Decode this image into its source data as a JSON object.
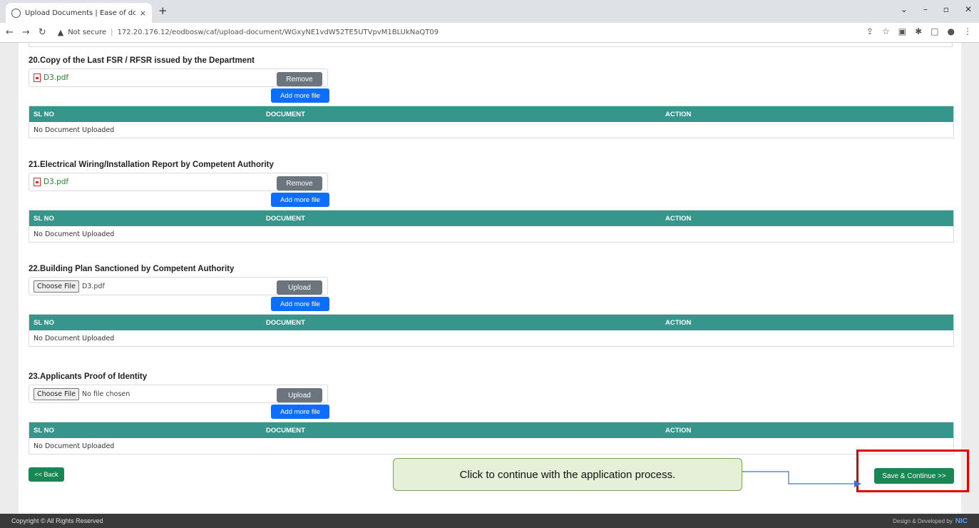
{
  "browser": {
    "tab_title": "Upload Documents | Ease of doi",
    "tab_close": "×",
    "new_tab": "+",
    "security": "Not secure",
    "url": "172.20.176.12/eodbosw/caf/upload-document/WGxyNE1vdW52TE5UTVpvM1BLUkNaQT09",
    "min": "–",
    "max": "▫",
    "close": "✕"
  },
  "table_headers": {
    "sl_no": "SL NO",
    "document": "DOCUMENT",
    "action": "ACTION"
  },
  "sections": [
    {
      "title": "20.Copy of the Last FSR / RFSR issued by the Department",
      "file": "D3.pdf",
      "button": "Remove",
      "add_more": "Add more file",
      "empty": "No Document Uploaded"
    },
    {
      "title": "21.Electrical Wiring/Installation Report by Competent Authority",
      "file": "D3.pdf",
      "button": "Remove",
      "add_more": "Add more file",
      "empty": "No Document Uploaded"
    },
    {
      "title": "22.Building Plan Sanctioned by Competent Authority",
      "choose": "Choose File",
      "file": "D3.pdf",
      "button": "Upload",
      "add_more": "Add more file",
      "empty": "No Document Uploaded"
    },
    {
      "title": "23.Applicants Proof of Identity",
      "choose": "Choose File",
      "file": "No file chosen",
      "button": "Upload",
      "add_more": "Add more file",
      "empty": "No Document Uploaded"
    }
  ],
  "back_label": "<< Back",
  "save_label": "Save & Continue >>",
  "callout_text": "Click to continue with the application process.",
  "footer": {
    "copyright": "Copyright © All Rights Reserved",
    "developed": "Design & Developed by",
    "logo": "NIC"
  },
  "colors": {
    "table_header": "#37968c",
    "primary": "#0d6efd",
    "success": "#198754",
    "highlight": "#e00000"
  }
}
